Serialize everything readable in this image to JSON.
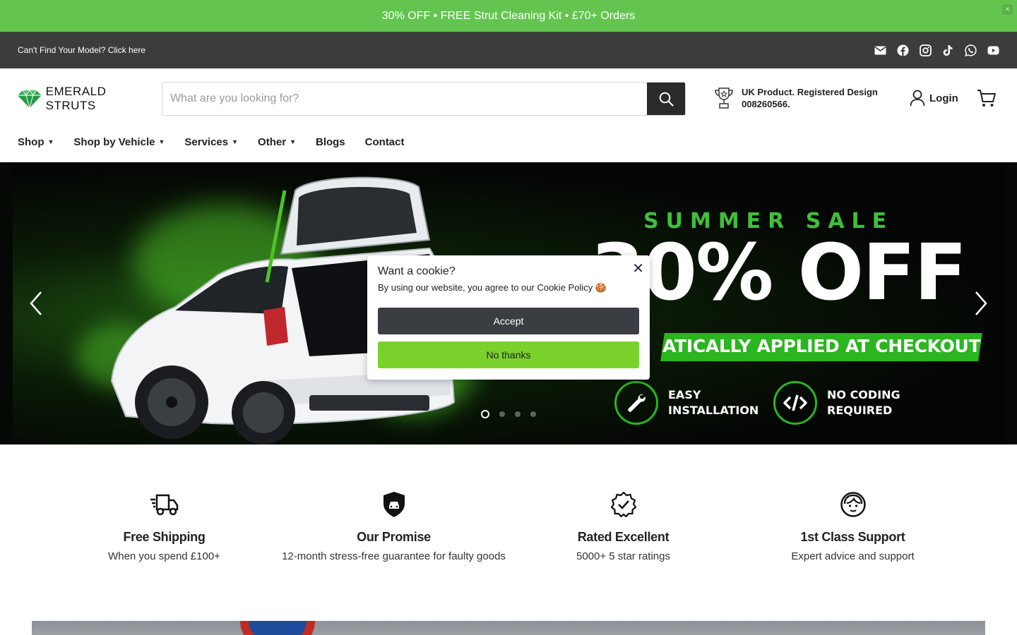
{
  "announcement": {
    "text": "30% OFF • FREE Strut Cleaning Kit • £70+ Orders",
    "close_glyph": "×"
  },
  "utility_bar": {
    "link_text": "Can't Find Your Model? Click here",
    "social_icons": [
      "email-icon",
      "facebook-icon",
      "instagram-icon",
      "tiktok-icon",
      "whatsapp-icon",
      "youtube-icon"
    ]
  },
  "header": {
    "logo_text": "EMERALD STRUTS",
    "search_placeholder": "What are you looking for?",
    "usp_text": "UK Product. Registered Design 008260566.",
    "login_label": "Login"
  },
  "nav": {
    "items": [
      {
        "label": "Shop",
        "has_dropdown": true
      },
      {
        "label": "Shop by Vehicle",
        "has_dropdown": true
      },
      {
        "label": "Services",
        "has_dropdown": true
      },
      {
        "label": "Other",
        "has_dropdown": true
      },
      {
        "label": "Blogs",
        "has_dropdown": false
      },
      {
        "label": "Contact",
        "has_dropdown": false
      }
    ]
  },
  "hero": {
    "sale_title": "SUMMER SALE",
    "sale_big": "30% OFF",
    "sale_strip": "ATICALLY APPLIED AT CHECKOUT",
    "features": [
      {
        "line1": "EASY",
        "line2": "INSTALLATION"
      },
      {
        "line1": "NO CODING",
        "line2": "REQUIRED"
      }
    ],
    "slide_count": 4,
    "active_slide": 1
  },
  "cookie": {
    "title": "Want a cookie?",
    "text": "By using our website, you agree to our Cookie Policy 🍪",
    "accept_label": "Accept",
    "decline_label": "No thanks",
    "close_glyph": "✕"
  },
  "benefits": [
    {
      "icon": "delivery-truck-icon",
      "title": "Free Shipping",
      "text": "When you spend £100+"
    },
    {
      "icon": "shield-car-icon",
      "title": "Our Promise",
      "text": "12-month stress-free guarantee for faulty goods"
    },
    {
      "icon": "verified-badge-icon",
      "title": "Rated Excellent",
      "text": "5000+ 5 star ratings"
    },
    {
      "icon": "support-agent-icon",
      "title": "1st Class Support",
      "text": "Expert advice and support"
    }
  ],
  "colors": {
    "announcement_bg": "#63c54f",
    "utility_bg": "#3c3c3c",
    "accent_green": "#2bb51f",
    "accept_bg": "#3a3d42",
    "decline_bg": "#7bd12c"
  }
}
